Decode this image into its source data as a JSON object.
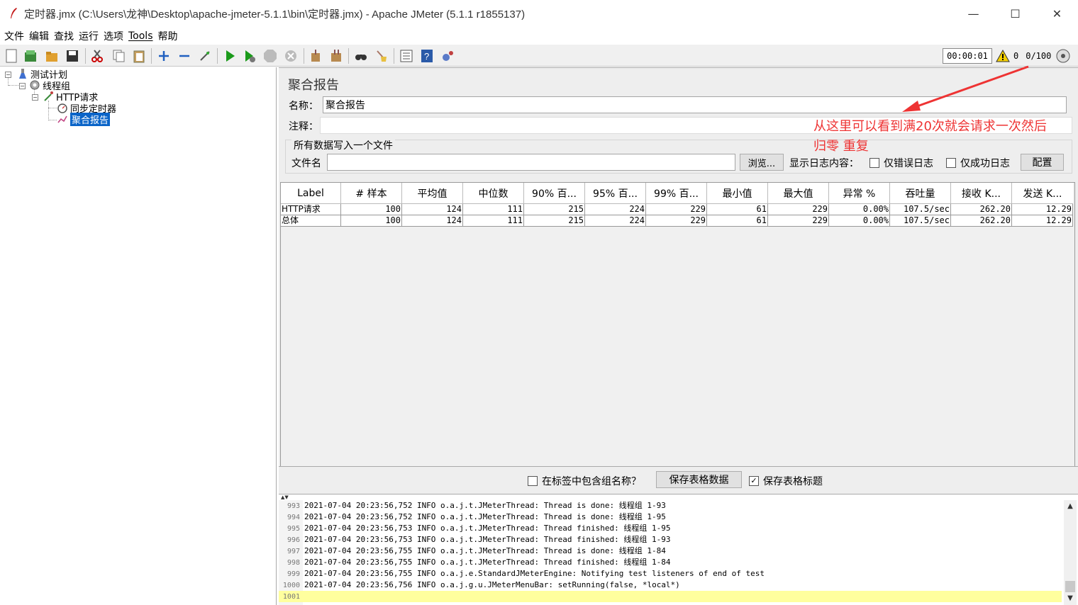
{
  "window": {
    "title": "定时器.jmx (C:\\Users\\龙神\\Desktop\\apache-jmeter-5.1.1\\bin\\定时器.jmx) - Apache JMeter (5.1.1 r1855137)"
  },
  "menu": [
    "文件",
    "编辑",
    "查找",
    "运行",
    "选项",
    "Tools",
    "帮助"
  ],
  "toolbar": {
    "elapsed": "00:00:01",
    "warnings": "0",
    "threads": "0/100"
  },
  "tree": {
    "root": "测试计划",
    "thread_group": "线程组",
    "http_request": "HTTP请求",
    "timer": "同步定时器",
    "report": "聚合报告"
  },
  "panel": {
    "title": "聚合报告",
    "name_label": "名称：",
    "name_value": "聚合报告",
    "comment_label": "注释：",
    "group_title": "所有数据写入一个文件",
    "filename_label": "文件名",
    "browse_button": "浏览...",
    "log_content_label": "显示日志内容：",
    "errors_only": "仅错误日志",
    "success_only": "仅成功日志",
    "configure_button": "配置"
  },
  "table": {
    "headers": [
      "Label",
      "# 样本",
      "平均值",
      "中位数",
      "90% 百...",
      "95% 百...",
      "99% 百...",
      "最小值",
      "最大值",
      "异常 %",
      "吞吐量",
      "接收 K...",
      "发送 K..."
    ],
    "rows": [
      [
        "HTTP请求",
        "100",
        "124",
        "111",
        "215",
        "224",
        "229",
        "61",
        "229",
        "0.00%",
        "107.5/sec",
        "262.20",
        "12.29"
      ],
      [
        "总体",
        "100",
        "124",
        "111",
        "215",
        "224",
        "229",
        "61",
        "229",
        "0.00%",
        "107.5/sec",
        "262.20",
        "12.29"
      ]
    ]
  },
  "bottom": {
    "include_group": "在标签中包含组名称？",
    "save_data_button": "保存表格数据",
    "save_header": "保存表格标题"
  },
  "log": [
    {
      "n": "993",
      "text": "2021-07-04 20:23:56,752 INFO o.a.j.t.JMeterThread: Thread is done: 线程组 1-93"
    },
    {
      "n": "994",
      "text": "2021-07-04 20:23:56,752 INFO o.a.j.t.JMeterThread: Thread is done: 线程组 1-95"
    },
    {
      "n": "995",
      "text": "2021-07-04 20:23:56,753 INFO o.a.j.t.JMeterThread: Thread finished: 线程组 1-95"
    },
    {
      "n": "996",
      "text": "2021-07-04 20:23:56,753 INFO o.a.j.t.JMeterThread: Thread finished: 线程组 1-93"
    },
    {
      "n": "997",
      "text": "2021-07-04 20:23:56,755 INFO o.a.j.t.JMeterThread: Thread is done: 线程组 1-84"
    },
    {
      "n": "998",
      "text": "2021-07-04 20:23:56,755 INFO o.a.j.t.JMeterThread: Thread finished: 线程组 1-84"
    },
    {
      "n": "999",
      "text": "2021-07-04 20:23:56,755 INFO o.a.j.e.StandardJMeterEngine: Notifying test listeners of end of test"
    },
    {
      "n": "1000",
      "text": "2021-07-04 20:23:56,756 INFO o.a.j.g.u.JMeterMenuBar: setRunning(false, *local*)"
    },
    {
      "n": "1001",
      "text": ""
    }
  ],
  "annotation": {
    "line1": "从这里可以看到满20次就会请求一次然后",
    "line2": "归零 重复",
    "color": "#ee3333"
  }
}
